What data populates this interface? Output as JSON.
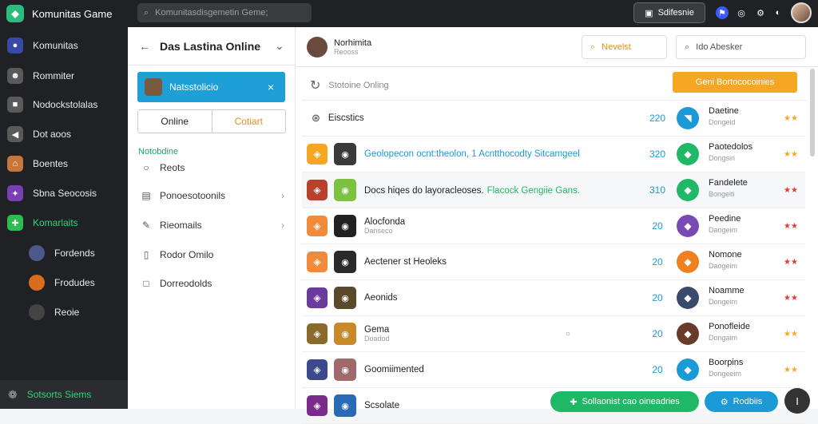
{
  "app": {
    "title": "Komunitas Game"
  },
  "search": {
    "placeholder": "Komunitasdisgemetin Geme;",
    "search_icon": "search-icon"
  },
  "topbar": {
    "button_label": "Sdifesnie"
  },
  "nav": {
    "items": [
      {
        "label": "Komunitas",
        "icon": "game-icon",
        "color": "#3949ab"
      },
      {
        "label": "Rommiter",
        "icon": "people-icon",
        "color": "#5a5a5a"
      },
      {
        "label": "Nodockstolalas",
        "icon": "briefcase-icon",
        "color": "#5a5a5a"
      },
      {
        "label": "Dot aoos",
        "icon": "megaphone-icon",
        "color": "#5a5a5a"
      },
      {
        "label": "Boentes",
        "icon": "home-icon",
        "color": "#c8763a"
      },
      {
        "label": "Sbna Seocosis",
        "icon": "puzzle-icon",
        "color": "#7b3fb4"
      },
      {
        "label": "Komarlaits",
        "icon": "controller-icon",
        "color": "#2bbd4e",
        "active": true
      }
    ],
    "subitems": [
      {
        "label": "Fordends",
        "color": "#4b5a8b"
      },
      {
        "label": "Frodudes",
        "color": "#d86d1d"
      },
      {
        "label": "Reoie",
        "color": "#444444"
      }
    ],
    "footer": "Sotsorts Siems"
  },
  "panel": {
    "title": "Das Lastina Online",
    "selected": "Natsstolicio",
    "toggle": [
      "Online",
      "Cotiart"
    ],
    "section": "Notobdine",
    "items": [
      {
        "label": "Reots",
        "icon": "radio-icon",
        "chevron": false
      },
      {
        "label": "Ponoesotoonils",
        "icon": "list-icon",
        "chevron": true
      },
      {
        "label": "Rieomails",
        "icon": "pencil-icon",
        "chevron": true
      },
      {
        "label": "Rodor Omilo",
        "icon": "book-icon",
        "chevron": false
      },
      {
        "label": "Dorreodolds",
        "icon": "square-icon",
        "chevron": false
      }
    ]
  },
  "content": {
    "user": {
      "name": "Norhimita",
      "sub": "Reooss"
    },
    "newest_label": "Nevelst",
    "search_placeholder": "Ido Abesker",
    "subbar_label": "Stotoine Onling",
    "orange_button": "Geni Bortococoinies",
    "header_row": {
      "label": "Eiscstics",
      "num": "220"
    },
    "rows": [
      {
        "title": "Geolopecon ocnt:theolon, 1 Acntthocodty Sitcamgeel",
        "sub": "",
        "num": "320",
        "color_sq": "#f5a623",
        "icon_color": "#3a3a3a",
        "highlight_title": true,
        "right_name": "Paotedolos",
        "right_sub": "Dongsiri",
        "stars": "★★",
        "star_color": "#f5a623",
        "circle": "#1fb866"
      },
      {
        "title": "Docs hiqes do layoracleoses.",
        "title2": "Flacock Gengiie Gans.",
        "sub": "",
        "num": "310",
        "color_sq": "#b9402a",
        "icon_color": "#7cc142",
        "right_name": "Fandelete",
        "right_sub": "Bongeiti",
        "stars": "★★",
        "star_color": "#e53935",
        "circle": "#1fb866",
        "hl": true
      },
      {
        "title": "Alocfonda",
        "sub": "Danseco",
        "num": "20",
        "color_sq": "#f28a3c",
        "icon_color": "#222222",
        "right_name": "Peedine",
        "right_sub": "Daogeim",
        "stars": "★★",
        "star_color": "#e53935",
        "circle": "#7a4ab4"
      },
      {
        "title": "Aectener st Heoleks",
        "sub": "",
        "num": "20",
        "color_sq": "#f28a3c",
        "icon_color": "#2a2a2a",
        "right_name": "Nomone",
        "right_sub": "Daogeim",
        "stars": "★★",
        "star_color": "#e53935",
        "circle": "#f08020"
      },
      {
        "title": "Aeonids",
        "sub": "",
        "num": "20",
        "color_sq": "#6a3a9c",
        "icon_color": "#5a4a2a",
        "right_name": "Noamme",
        "right_sub": "Dongeim",
        "stars": "★★",
        "star_color": "#e53935",
        "circle": "#3a4a6a"
      },
      {
        "title": "Gema",
        "sub": "Doadod",
        "num": "20",
        "mid_mark": "○",
        "color_sq": "#8a6a2a",
        "icon_color": "#c88a2a",
        "right_name": "Ponofleide",
        "right_sub": "Dongaim",
        "stars": "★★",
        "star_color": "#f5a623",
        "circle": "#6a3a2a"
      },
      {
        "title": "Goomiimented",
        "sub": "",
        "num": "20",
        "color_sq": "#3a4a8a",
        "icon_color": "#a06a6a",
        "right_name": "Boorpins",
        "right_sub": "Dongeeim",
        "stars": "★★",
        "star_color": "#f5a623",
        "circle": "#1b9ad6"
      },
      {
        "title": "Scsolate",
        "sub": "",
        "num": "",
        "color_sq": "#7a2a8a",
        "icon_color": "#2a6ab4",
        "right_name": "",
        "right_sub": "",
        "stars": "",
        "star_color": "#f5a623",
        "circle": ""
      }
    ]
  },
  "footer_buttons": {
    "primary": "Sollaonist cao oineadries",
    "secondary": "Rodbiis",
    "fab": "I"
  }
}
